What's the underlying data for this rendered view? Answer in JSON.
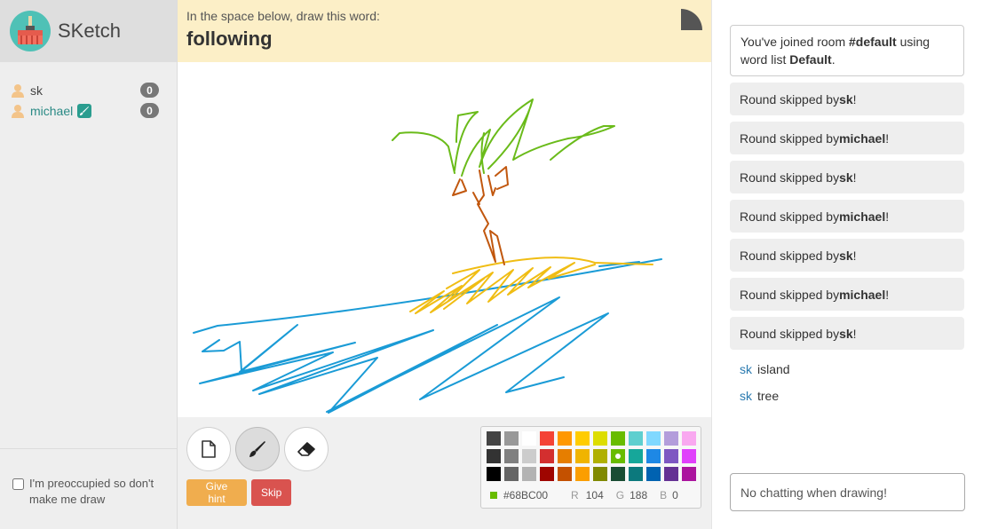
{
  "app": {
    "name": "SKetch"
  },
  "players": [
    {
      "name": "sk",
      "score": "0",
      "drawing": false
    },
    {
      "name": "michael",
      "score": "0",
      "drawing": true
    }
  ],
  "preoccupied_label": "I'm preoccupied so don't make me draw",
  "prompt": {
    "label": "In the space below, draw this word:",
    "word": "following"
  },
  "buttons": {
    "hint": "Give hint",
    "skip": "Skip"
  },
  "tools": [
    "new-page-icon",
    "brush-icon",
    "eraser-icon"
  ],
  "palette": {
    "colors": [
      "#444444",
      "#999999",
      "#ffffff",
      "#f44336",
      "#ff9800",
      "#ffcc00",
      "#dddd00",
      "#68bc00",
      "#5fcfcf",
      "#80d8ff",
      "#b39ddb",
      "#f9a8f0",
      "#333333",
      "#808080",
      "#cccccc",
      "#d32f2f",
      "#e67e00",
      "#f0b400",
      "#b0b000",
      "#68bc00",
      "#16a79a",
      "#1e88e5",
      "#7e57c2",
      "#e040fb",
      "#000000",
      "#666666",
      "#b3b3b3",
      "#9f0500",
      "#c45100",
      "#fb9e00",
      "#808900",
      "#194d33",
      "#0c797d",
      "#0062b1",
      "#653294",
      "#ab149e"
    ],
    "selected": "#68BC00",
    "hex": "#68BC00",
    "r": "104",
    "g": "188",
    "b": "0",
    "r_label": "R",
    "g_label": "G",
    "b_label": "B"
  },
  "chat": {
    "join": {
      "pre": "You've joined room ",
      "room": "#default",
      "mid": " using word list ",
      "list": "Default",
      "post": "."
    },
    "skips": [
      {
        "text": "Round skipped by ",
        "user": "sk",
        "end": "!"
      },
      {
        "text": "Round skipped by ",
        "user": "michael",
        "end": "!"
      },
      {
        "text": "Round skipped by ",
        "user": "sk",
        "end": "!"
      },
      {
        "text": "Round skipped by ",
        "user": "michael",
        "end": "!"
      },
      {
        "text": "Round skipped by ",
        "user": "sk",
        "end": "!"
      },
      {
        "text": "Round skipped by ",
        "user": "michael",
        "end": "!"
      },
      {
        "text": "Round skipped by ",
        "user": "sk",
        "end": "!"
      }
    ],
    "messages": [
      {
        "user": "sk",
        "text": "island"
      },
      {
        "user": "sk",
        "text": "tree"
      }
    ],
    "input_placeholder": "No chatting when drawing!"
  },
  "colors": {
    "accent": "#4fc1b6",
    "hint": "#f0ad4e",
    "skip": "#d9534f",
    "prompt_bg": "#fcefc7",
    "user_link": "#2a7ab0"
  }
}
